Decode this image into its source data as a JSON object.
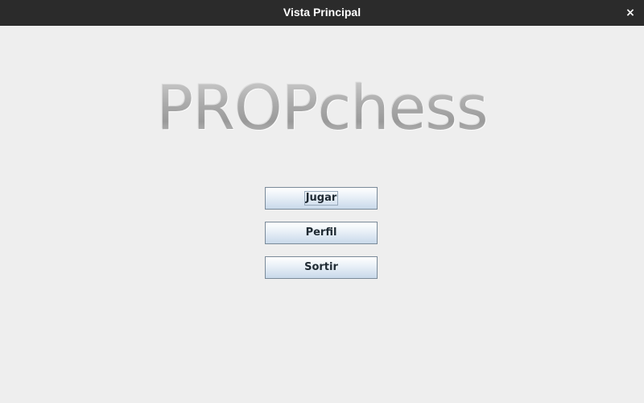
{
  "window": {
    "title": "Vista Principal",
    "close_glyph": "×",
    "close_icon": "close-icon"
  },
  "main": {
    "logo_text": "PROPchess",
    "buttons": {
      "jugar": "Jugar",
      "perfil": "Perfil",
      "sortir": "Sortir"
    },
    "focused_button": "Jugar"
  },
  "colors": {
    "titlebar_bg": "#2b2b2b",
    "window_bg": "#eeeeee",
    "button_border": "#7a8a99",
    "logo_gray": "#a9a9a9"
  }
}
